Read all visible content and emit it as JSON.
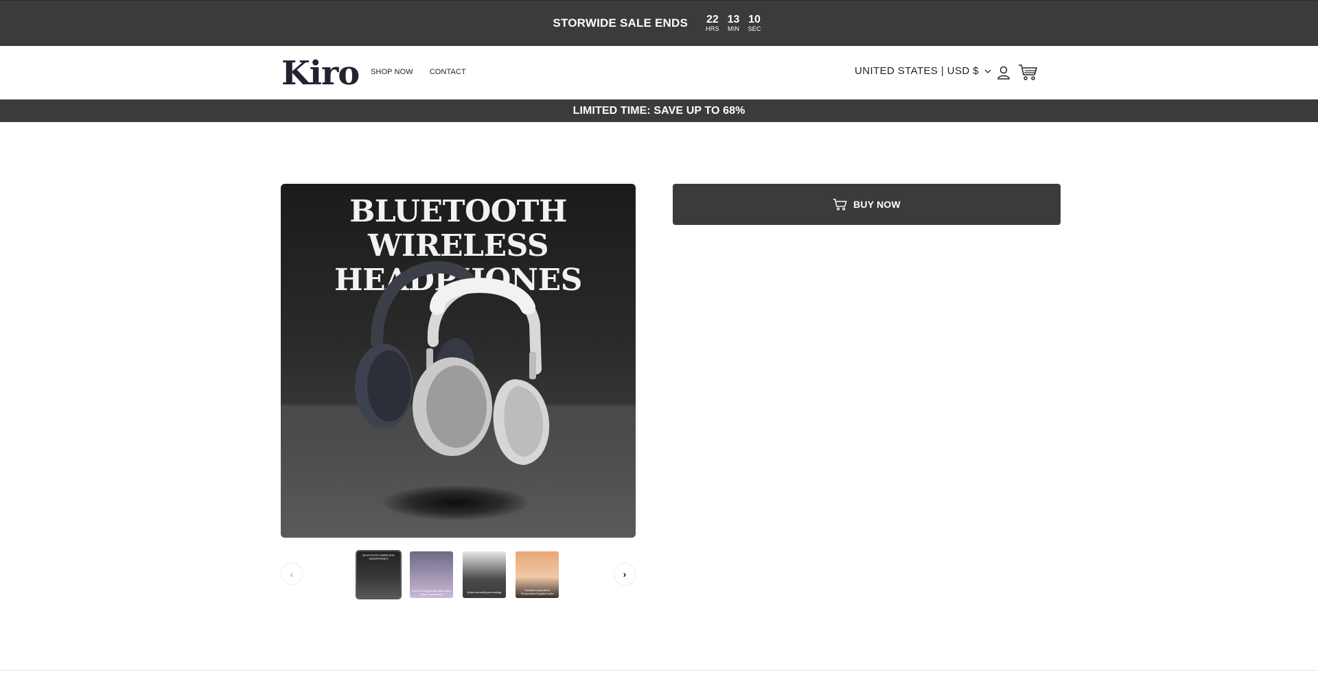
{
  "countdown": {
    "title": "STORWIDE SALE ENDS",
    "hours": "22",
    "hours_label": "HRS",
    "minutes": "13",
    "minutes_label": "MIN",
    "seconds": "10",
    "seconds_label": "SEC"
  },
  "header": {
    "logo": "Kiro",
    "nav": [
      "SHOP NOW",
      "CONTACT"
    ],
    "locale": "UNITED STATES | USD $"
  },
  "promo": {
    "text": "LIMITED TIME: SAVE UP TO 68%"
  },
  "product": {
    "hero_title_line1": "BLUETOOTH",
    "hero_title_line2": "WIRELESS HEADPHONES",
    "buy_label": "BUY NOW",
    "thumbnails": [
      {
        "caption": "BLUETOOTH WIRELESS HEADPHONES"
      },
      {
        "caption": "Hi-Res Fidelity Audio with Active Noise Cancellation"
      },
      {
        "caption": "Noise-cancelling technology"
      },
      {
        "caption": "Transform yourself in Personalized Spatial Audio"
      }
    ]
  },
  "colors": {
    "bar": "#3b3b3b",
    "background": "#ffffff",
    "logo": "#222233"
  }
}
